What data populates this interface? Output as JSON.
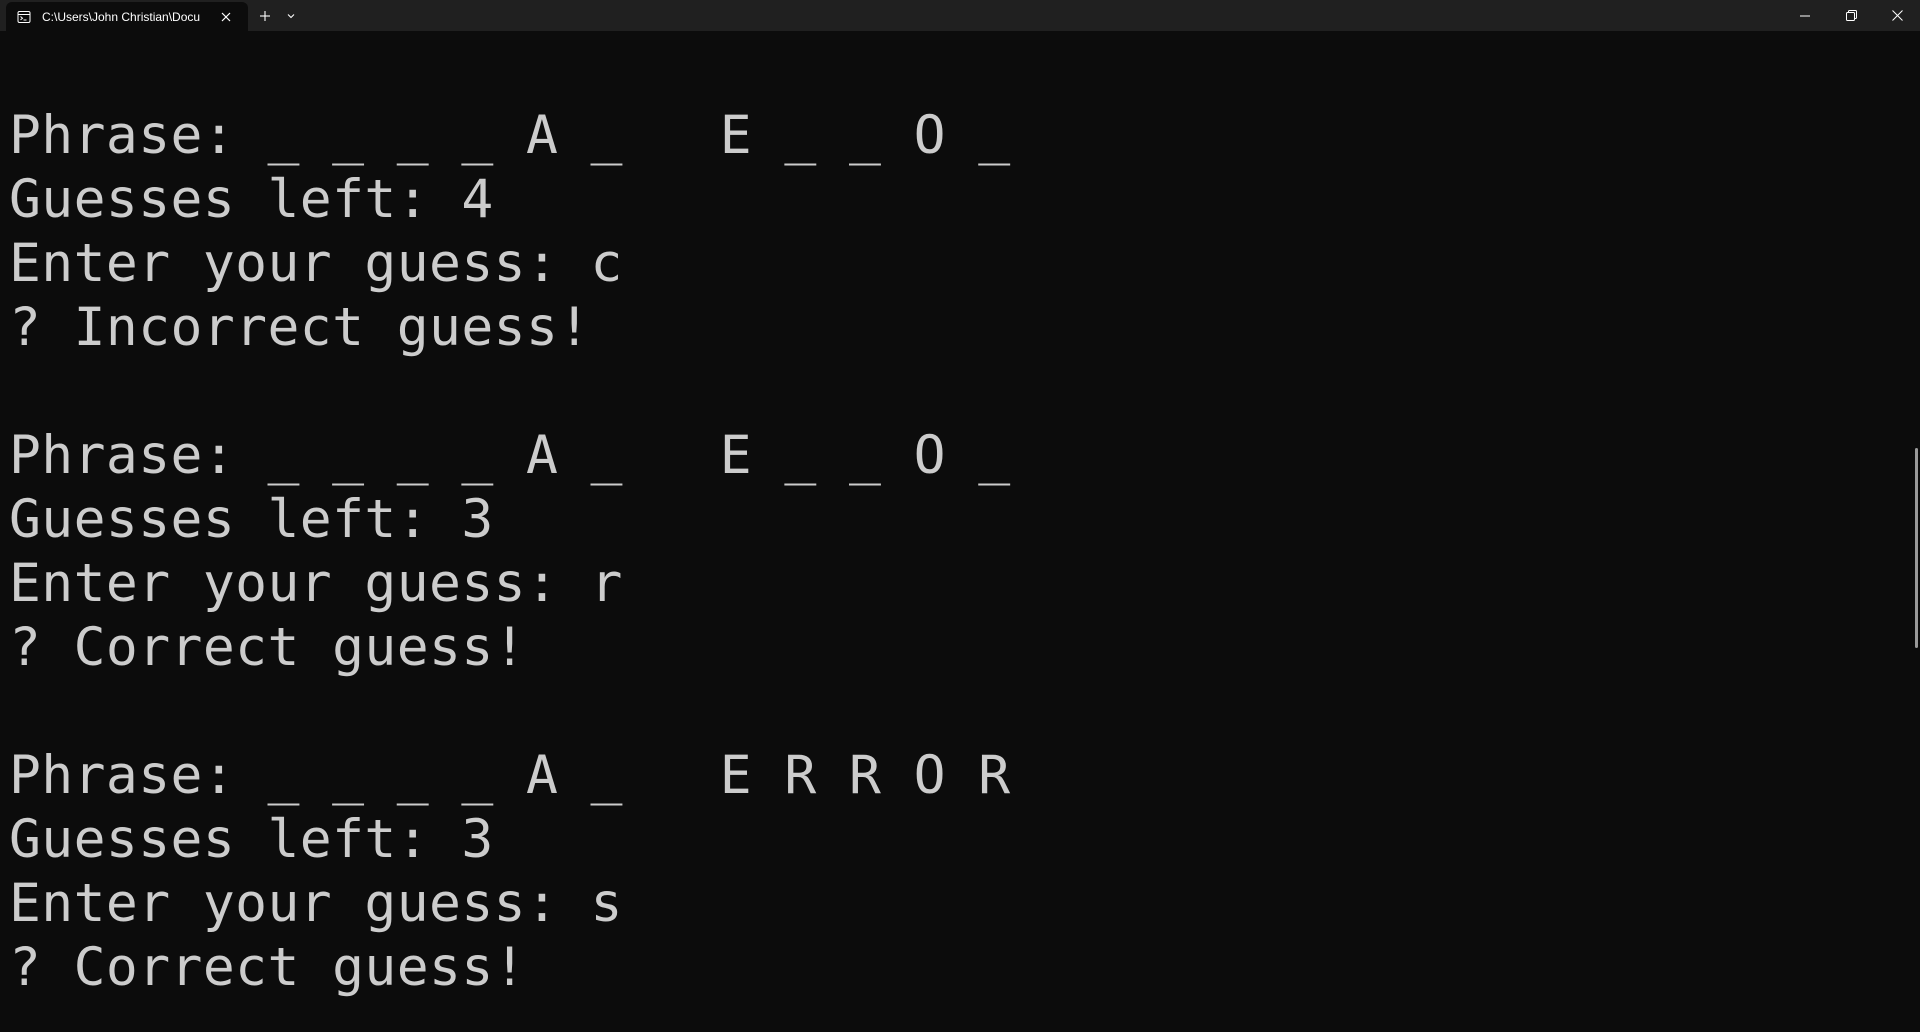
{
  "window": {
    "tab_title": "C:\\Users\\John Christian\\Docu",
    "tab_icon": "terminal-icon",
    "close_tab_icon": "close-icon",
    "new_tab_icon": "plus-icon",
    "dropdown_icon": "chevron-down-icon",
    "controls": [
      "minimize-icon",
      "restore-icon",
      "close-icon"
    ]
  },
  "terminal": {
    "lines": [
      "Phrase: _ _ _ _ A _   E _ _ O _",
      "Guesses left: 4",
      "Enter your guess: c",
      "? Incorrect guess!",
      "",
      "Phrase: _ _ _ _ A _   E _ _ O _",
      "Guesses left: 3",
      "Enter your guess: r",
      "? Correct guess!",
      "",
      "Phrase: _ _ _ _ A _   E R R O R",
      "Guesses left: 3",
      "Enter your guess: s",
      "? Correct guess!"
    ]
  },
  "colors": {
    "background": "#0c0c0c",
    "titlebar": "#202020",
    "text": "#cccccc"
  }
}
